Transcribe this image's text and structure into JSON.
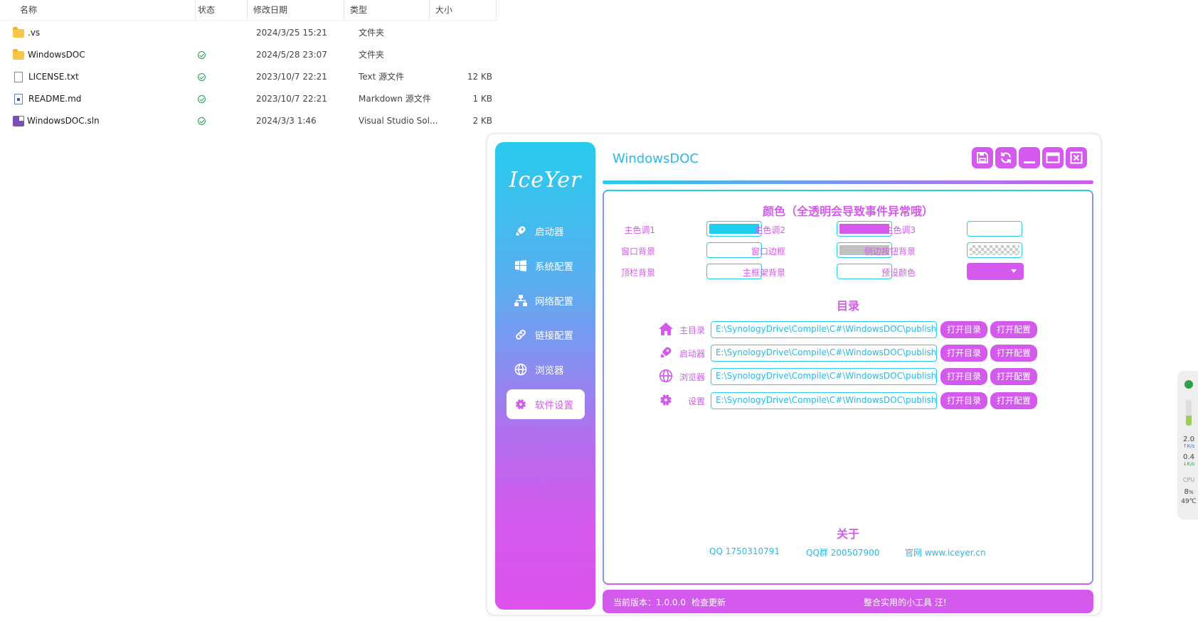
{
  "explorer": {
    "columns": {
      "name": "名称",
      "status": "状态",
      "modified": "修改日期",
      "type": "类型",
      "size": "大小"
    },
    "files": [
      {
        "name": ".vs",
        "icon": "folder-icon",
        "status": "",
        "modified": "2024/3/25 15:21",
        "type": "文件夹",
        "size": ""
      },
      {
        "name": "WindowsDOC",
        "icon": "folder-icon",
        "status": "synced",
        "modified": "2024/5/28 23:07",
        "type": "文件夹",
        "size": ""
      },
      {
        "name": "LICENSE.txt",
        "icon": "text-file-icon",
        "status": "synced",
        "modified": "2023/10/7 22:21",
        "type": "Text 源文件",
        "size": "12 KB"
      },
      {
        "name": "README.md",
        "icon": "markdown-file-icon",
        "status": "synced",
        "modified": "2023/10/7 22:21",
        "type": "Markdown 源文件",
        "size": "1 KB"
      },
      {
        "name": "WindowsDOC.sln",
        "icon": "solution-file-icon",
        "status": "synced",
        "modified": "2024/3/3 1:46",
        "type": "Visual Studio Sol...",
        "size": "2 KB"
      }
    ]
  },
  "app": {
    "logo": "IceYer",
    "title": "WindowsDOC",
    "accent1": "#29cbee",
    "accent2": "#d35aec",
    "nav": [
      {
        "label": "启动器",
        "icon": "rocket-icon"
      },
      {
        "label": "系统配置",
        "icon": "windows-icon"
      },
      {
        "label": "网络配置",
        "icon": "network-icon"
      },
      {
        "label": "链接配置",
        "icon": "link-icon"
      },
      {
        "label": "浏览器",
        "icon": "globe-icon"
      },
      {
        "label": "软件设置",
        "icon": "gear-icon",
        "active": true
      }
    ],
    "colors": {
      "title": "颜色（全透明会导致事件异常哦）",
      "primary1_label": "主色调1",
      "primary2_label": "主色调2",
      "primary3_label": "主色调3",
      "window_bg_label": "窗口背景",
      "window_border_label": "窗口边框",
      "side_btn_bg_label": "侧边按钮背景",
      "topbar_bg_label": "顶栏背景",
      "main_frame_bg_label": "主框架背景",
      "preset_label": "预设颜色",
      "primary1": "#1ccfee",
      "primary2": "#d35aec",
      "window_border": "#c0c0c0"
    },
    "dirs": {
      "title": "目录",
      "rows": [
        {
          "label": "主目录",
          "icon": "home-icon",
          "path": "E:\\SynologyDrive\\Compile\\C#\\WindowsDOC\\publish\\"
        },
        {
          "label": "启动器",
          "icon": "rocket-icon",
          "path": "E:\\SynologyDrive\\Compile\\C#\\WindowsDOC\\publish\\"
        },
        {
          "label": "浏览器",
          "icon": "globe-icon",
          "path": "E:\\SynologyDrive\\Compile\\C#\\WindowsDOC\\publish\\"
        },
        {
          "label": "设置",
          "icon": "gear-icon",
          "path": "E:\\SynologyDrive\\Compile\\C#\\WindowsDOC\\publish\\"
        }
      ],
      "open_dir_label": "打开目录",
      "open_config_label": "打开配置"
    },
    "about": {
      "title": "关于",
      "qq": "QQ 1750310791",
      "qq_group": "QQ群 200507900",
      "website": "官网 www.iceyer.cn"
    },
    "footer": {
      "version": "当前版本：1.0.0.0",
      "check_update": "检查更新",
      "slogan": "整合实用的小工具 汪!"
    }
  },
  "widget": {
    "up_speed": "2.0",
    "up_unit": "K/s",
    "down_speed": "0.4",
    "down_unit": "K/s",
    "cpu_label": "CPU",
    "cpu_percent": "8",
    "cpu_unit": "%",
    "temperature": "49℃"
  }
}
